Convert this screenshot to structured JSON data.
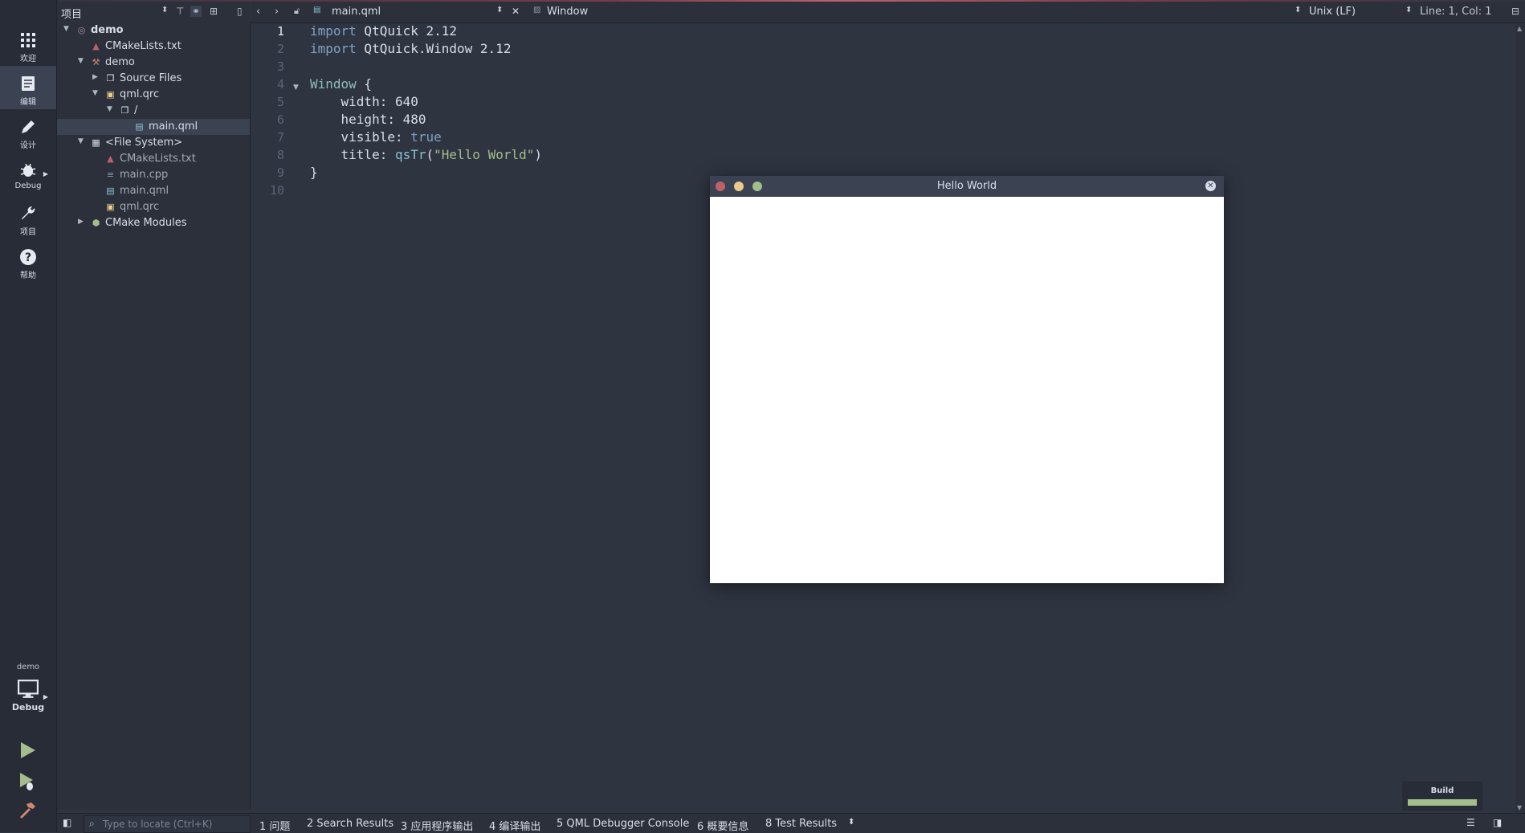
{
  "project_panel": {
    "title": "项目",
    "tree": [
      {
        "label": "demo",
        "indent": 0,
        "expanded": true,
        "icon": "project-icon",
        "bold": true
      },
      {
        "label": "CMakeLists.txt",
        "indent": 1,
        "icon": "cmake-icon"
      },
      {
        "label": "demo",
        "indent": 1,
        "expanded": true,
        "icon": "hammer-icon"
      },
      {
        "label": "Source Files",
        "indent": 2,
        "expanded": false,
        "icon": "folder-icon"
      },
      {
        "label": "qml.qrc",
        "indent": 2,
        "expanded": true,
        "icon": "qrc-icon"
      },
      {
        "label": "/",
        "indent": 3,
        "expanded": true,
        "icon": "folder-icon"
      },
      {
        "label": "main.qml",
        "indent": 4,
        "icon": "qml-file-icon",
        "selected": true
      },
      {
        "label": "<File System>",
        "indent": 1,
        "expanded": true,
        "icon": "filesystem-icon"
      },
      {
        "label": "CMakeLists.txt",
        "indent": 2,
        "icon": "cmake-icon",
        "dim": true
      },
      {
        "label": "main.cpp",
        "indent": 2,
        "icon": "cpp-file-icon",
        "dim": true
      },
      {
        "label": "main.qml",
        "indent": 2,
        "icon": "qml-file-icon",
        "dim": true
      },
      {
        "label": "qml.qrc",
        "indent": 2,
        "icon": "qrc-icon",
        "dim": true
      },
      {
        "label": "CMake Modules",
        "indent": 1,
        "expanded": false,
        "icon": "cmake-modules-icon"
      }
    ]
  },
  "modes": [
    {
      "label": "欢迎",
      "icon": "grid-icon"
    },
    {
      "label": "编辑",
      "icon": "edit-icon",
      "active": true
    },
    {
      "label": "设计",
      "icon": "pencil-icon"
    },
    {
      "label": "Debug",
      "icon": "bug-icon"
    },
    {
      "label": "项目",
      "icon": "wrench-icon"
    },
    {
      "label": "帮助",
      "icon": "help-icon"
    }
  ],
  "target": {
    "project": "demo",
    "config": "Debug"
  },
  "editor_toolbar": {
    "file": "main.qml",
    "symbol": "Window",
    "line_ending": "Unix (LF)",
    "position": "Line: 1, Col: 1"
  },
  "code_lines": [
    "import QtQuick 2.12",
    "import QtQuick.Window 2.12",
    "",
    "Window {",
    "    width: 640",
    "    height: 480",
    "    visible: true",
    "    title: qsTr(\"Hello World\")",
    "}",
    ""
  ],
  "app_window": {
    "title": "Hello World"
  },
  "output_panes": {
    "locate_placeholder": "Type to locate (Ctrl+K)",
    "tabs": [
      "1  问题",
      "2  Search Results",
      "3  应用程序输出",
      "4  编译输出",
      "5  QML Debugger Console",
      "6  概要信息",
      "8  Test Results"
    ]
  },
  "build_progress": {
    "label": "Build",
    "fraction": 1.0,
    "color": "#a3be8c"
  }
}
